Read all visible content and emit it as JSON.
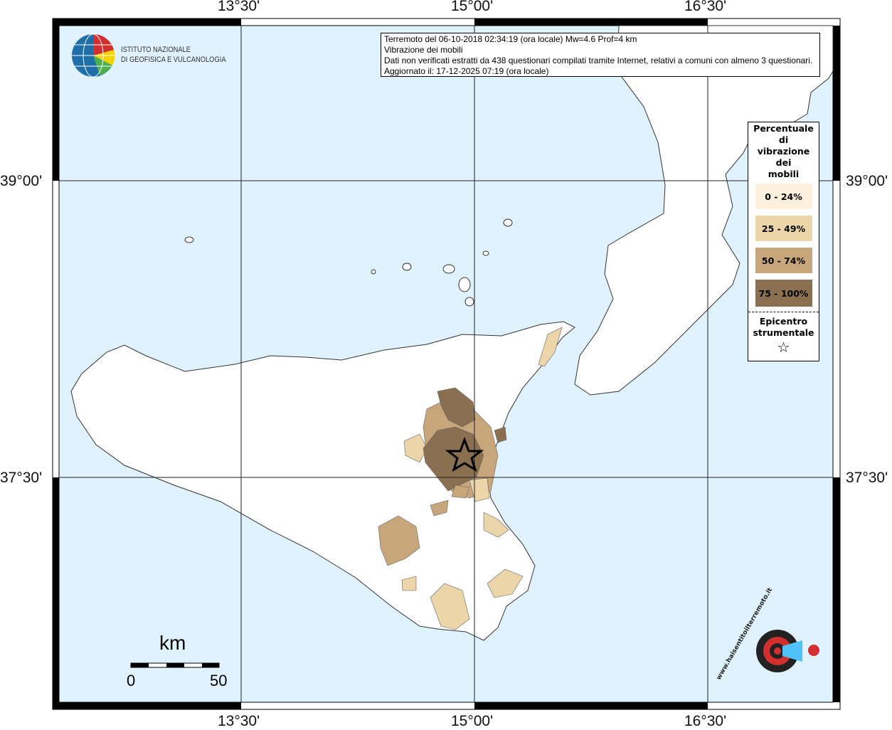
{
  "map": {
    "lon_ticks": [
      "13°30'",
      "15°00'",
      "16°30'"
    ],
    "lat_ticks": [
      "39°00'",
      "37°30'"
    ],
    "water_color": "#e0f2fd",
    "land_color": "#ffffff"
  },
  "info": {
    "line1": "Terremoto del 06-10-2018 02:34:19 (ora locale) Mw=4.6 Prof=4 km",
    "line2": "Vibrazione dei mobili",
    "line3": "Dati non verificati estratti da 438 questionari compilati tramite Internet, relativi a comuni con almeno 3 questionari.",
    "line4": "Aggiornato il: 17-12-2025 07:19 (ora locale)"
  },
  "logo": {
    "line1": "ISTITUTO NAZIONALE",
    "line2": "DI GEOFISICA E VULCANOLOGIA"
  },
  "legend": {
    "title_lines": [
      "Percentuale",
      "di",
      "vibrazione",
      "dei",
      "mobili"
    ],
    "classes": [
      {
        "label": "0 - 24%",
        "color": "#fdf0dc"
      },
      {
        "label": "25 - 49%",
        "color": "#ecd6a9"
      },
      {
        "label": "50 - 74%",
        "color": "#c8a67c"
      },
      {
        "label": "75 - 100%",
        "color": "#8a6f50"
      }
    ],
    "epicenter_lines": [
      "Epicentro",
      "strumentale"
    ],
    "epicenter_symbol": "☆"
  },
  "scale": {
    "unit": "km",
    "min": "0",
    "max": "50"
  },
  "brand": {
    "text": "www.haisentitoilterremoto.it"
  }
}
